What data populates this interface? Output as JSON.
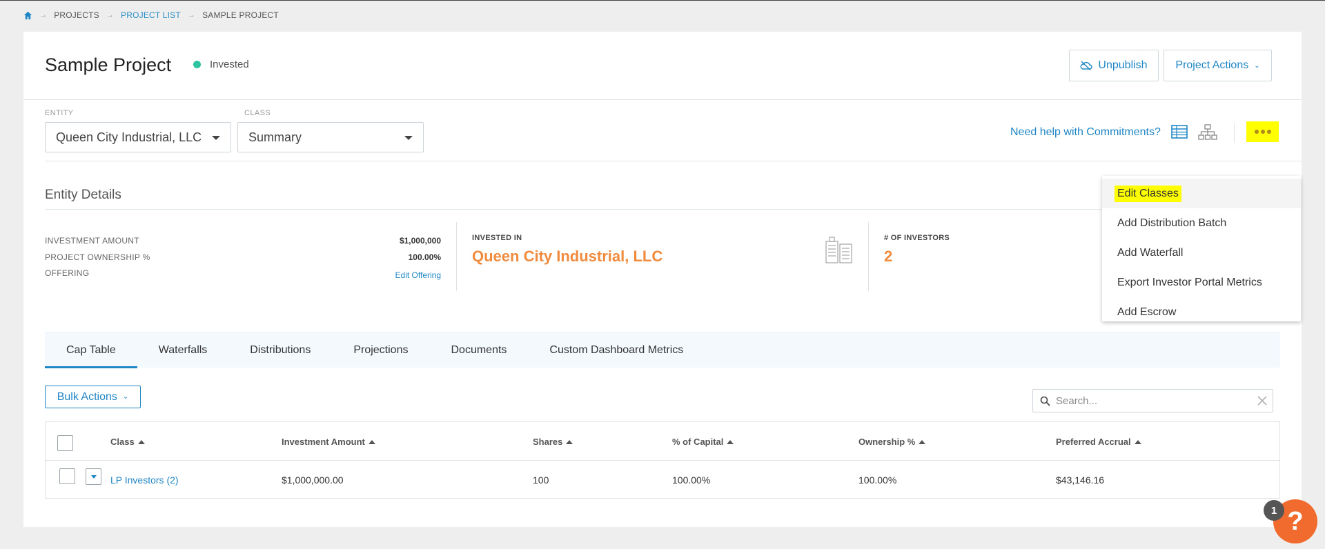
{
  "breadcrumb": {
    "items": [
      "PROJECTS",
      "PROJECT LIST",
      "SAMPLE PROJECT"
    ]
  },
  "header": {
    "title": "Sample Project",
    "status": "Invested",
    "unpublish_label": "Unpublish",
    "project_actions_label": "Project Actions"
  },
  "selectors": {
    "entity_label": "ENTITY",
    "entity_value": "Queen City Industrial, LLC",
    "class_label": "CLASS",
    "class_value": "Summary"
  },
  "toolbar": {
    "help_link": "Need help with Commitments?"
  },
  "entity_details": {
    "title": "Entity Details",
    "rows": [
      {
        "label": "INVESTMENT AMOUNT",
        "value": "$1,000,000"
      },
      {
        "label": "PROJECT OWNERSHIP %",
        "value": "100.00%"
      },
      {
        "label": "OFFERING",
        "value": "Edit Offering"
      }
    ],
    "invested_in_label": "INVESTED IN",
    "invested_in_value": "Queen City Industrial, LLC",
    "investors_label": "# OF INVESTORS",
    "investors_value": "2"
  },
  "tabs": [
    "Cap Table",
    "Waterfalls",
    "Distributions",
    "Projections",
    "Documents",
    "Custom Dashboard Metrics"
  ],
  "bulk_actions_label": "Bulk Actions",
  "search": {
    "placeholder": "Search..."
  },
  "table": {
    "columns": [
      "Class",
      "Investment Amount",
      "Shares",
      "% of Capital",
      "Ownership %",
      "Preferred Accrual"
    ],
    "rows": [
      {
        "class": "LP Investors (2)",
        "investment": "$1,000,000.00",
        "shares": "100",
        "capital": "100.00%",
        "ownership": "100.00%",
        "accrual": "$43,146.16"
      }
    ]
  },
  "menu": {
    "items": [
      "Edit Classes",
      "Add Distribution Batch",
      "Add Waterfall",
      "Export Investor Portal Metrics",
      "Add Escrow"
    ]
  },
  "help_widget": {
    "badge": "1",
    "glyph": "?"
  },
  "colors": {
    "accent": "#1f86c6",
    "orange": "#f08a3c",
    "status_green": "#2ec4a0",
    "highlight": "#ffff00"
  }
}
